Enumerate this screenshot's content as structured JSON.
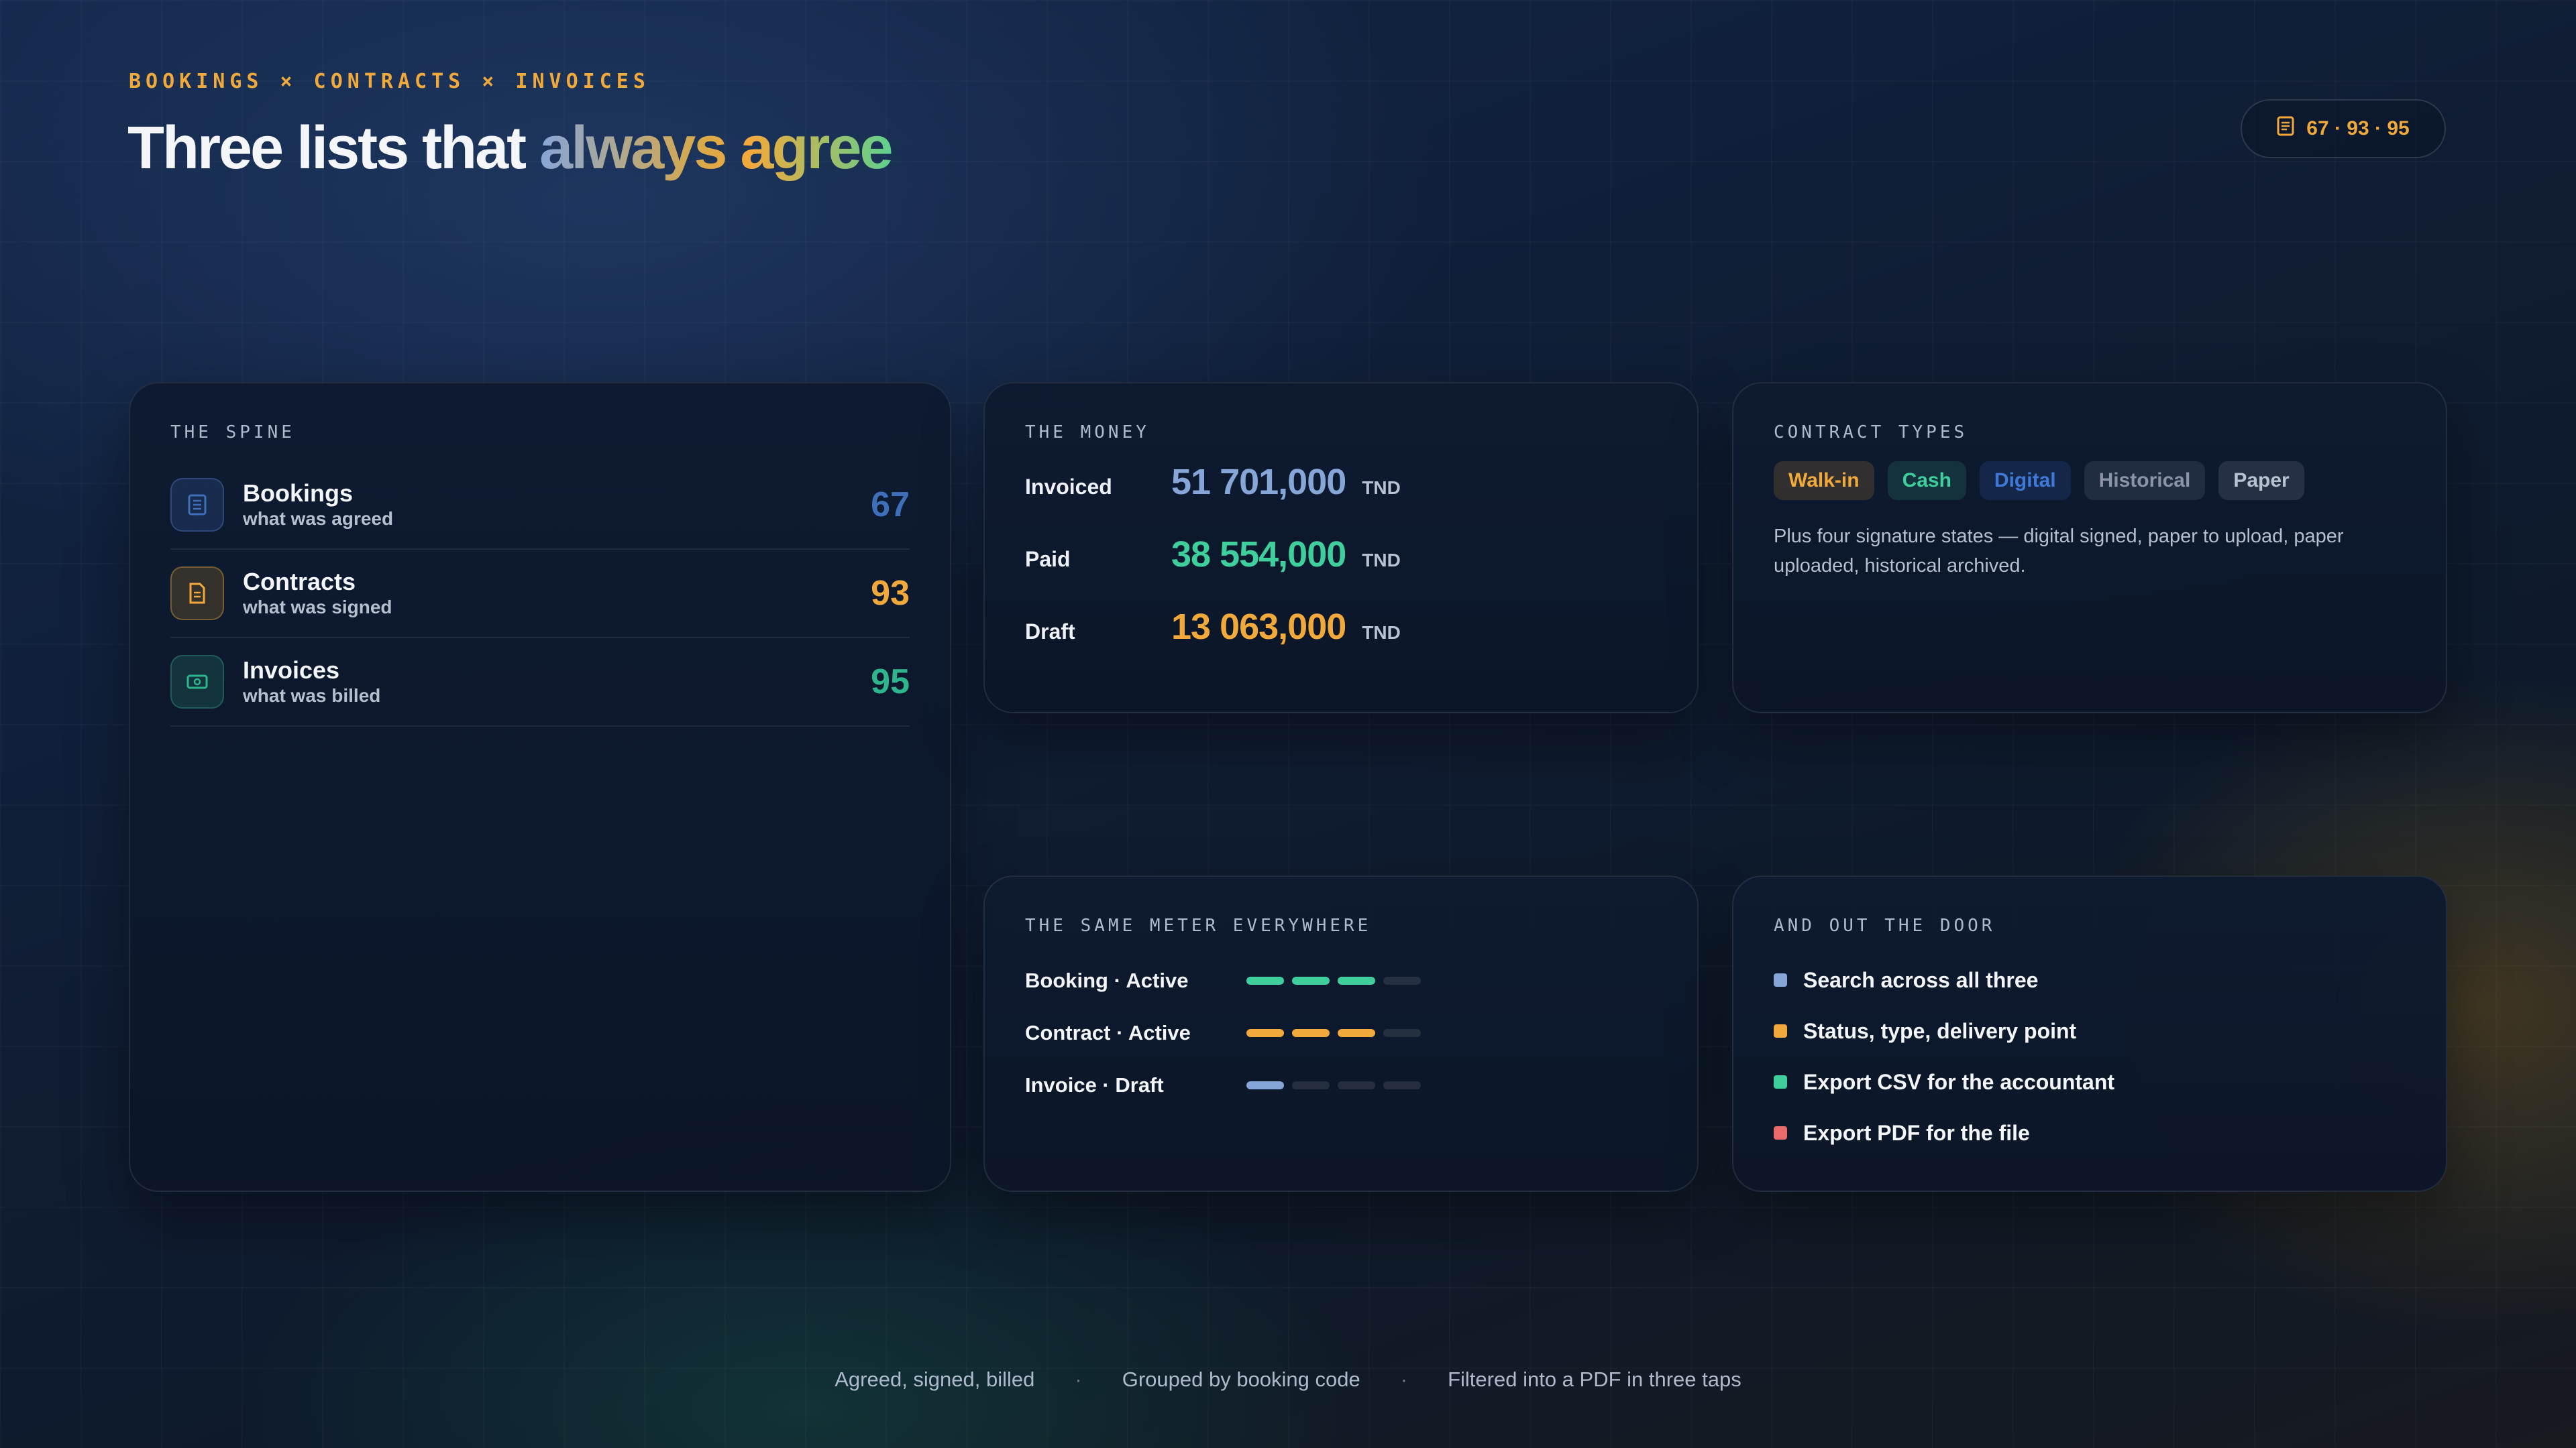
{
  "header": {
    "eyebrow": "BOOKINGS × CONTRACTS × INVOICES",
    "headline_plain": "Three lists that",
    "headline_gradient": "always agree",
    "counter_icon": "document-icon",
    "counter_text": "67 · 93 · 95"
  },
  "spine": {
    "label": "THE SPINE",
    "rows": [
      {
        "title": "Bookings",
        "subtitle": "what was agreed",
        "count": "67",
        "icon": "list-icon",
        "color": "#3f6fb8"
      },
      {
        "title": "Contracts",
        "subtitle": "what was signed",
        "count": "93",
        "icon": "document-icon",
        "color": "#f2a93b"
      },
      {
        "title": "Invoices",
        "subtitle": "what was billed",
        "count": "95",
        "icon": "banknote-icon",
        "color": "#2fb58c"
      }
    ]
  },
  "money": {
    "label": "THE MONEY",
    "rows": [
      {
        "label": "Invoiced",
        "value": "51 701,000",
        "unit": "TND",
        "color": "#86a6d8"
      },
      {
        "label": "Paid",
        "value": "38 554,000",
        "unit": "TND",
        "color": "#3ecf9c"
      },
      {
        "label": "Draft",
        "value": "13 063,000",
        "unit": "TND",
        "color": "#f2a93b"
      }
    ]
  },
  "contract_types": {
    "label": "CONTRACT TYPES",
    "tags": [
      {
        "text": "Walk-in",
        "color": "#f2a93b",
        "bg": "rgba(242,169,59,0.16)"
      },
      {
        "text": "Cash",
        "color": "#3ecf9c",
        "bg": "rgba(62,207,156,0.14)"
      },
      {
        "text": "Digital",
        "color": "#3f79d8",
        "bg": "rgba(63,121,216,0.16)"
      },
      {
        "text": "Historical",
        "color": "#8a94a6",
        "bg": "rgba(138,148,166,0.16)"
      },
      {
        "text": "Paper",
        "color": "#b9c2d0",
        "bg": "rgba(185,194,208,0.14)"
      }
    ],
    "description": "Plus four signature states — digital signed, paper to upload, paper uploaded, historical archived."
  },
  "meter": {
    "label": "THE SAME METER EVERYWHERE",
    "rows": [
      {
        "label": "Booking · Active",
        "filled": 3,
        "total": 4,
        "color": "#3ecf9c"
      },
      {
        "label": "Contract · Active",
        "filled": 3,
        "total": 4,
        "color": "#f2a93b"
      },
      {
        "label": "Invoice · Draft",
        "filled": 1,
        "total": 4,
        "color": "#86a6d8"
      }
    ]
  },
  "door": {
    "label": "AND OUT THE DOOR",
    "items": [
      {
        "text": "Search across all three",
        "color": "#86a6d8"
      },
      {
        "text": "Status, type, delivery point",
        "color": "#f2a93b"
      },
      {
        "text": "Export CSV for the accountant",
        "color": "#3ecf9c"
      },
      {
        "text": "Export PDF for the file",
        "color": "#e86a6a"
      }
    ]
  },
  "footer": {
    "items": [
      "Agreed, signed, billed",
      "Grouped by booking code",
      "Filtered into a PDF in three taps"
    ],
    "separator": "·"
  }
}
